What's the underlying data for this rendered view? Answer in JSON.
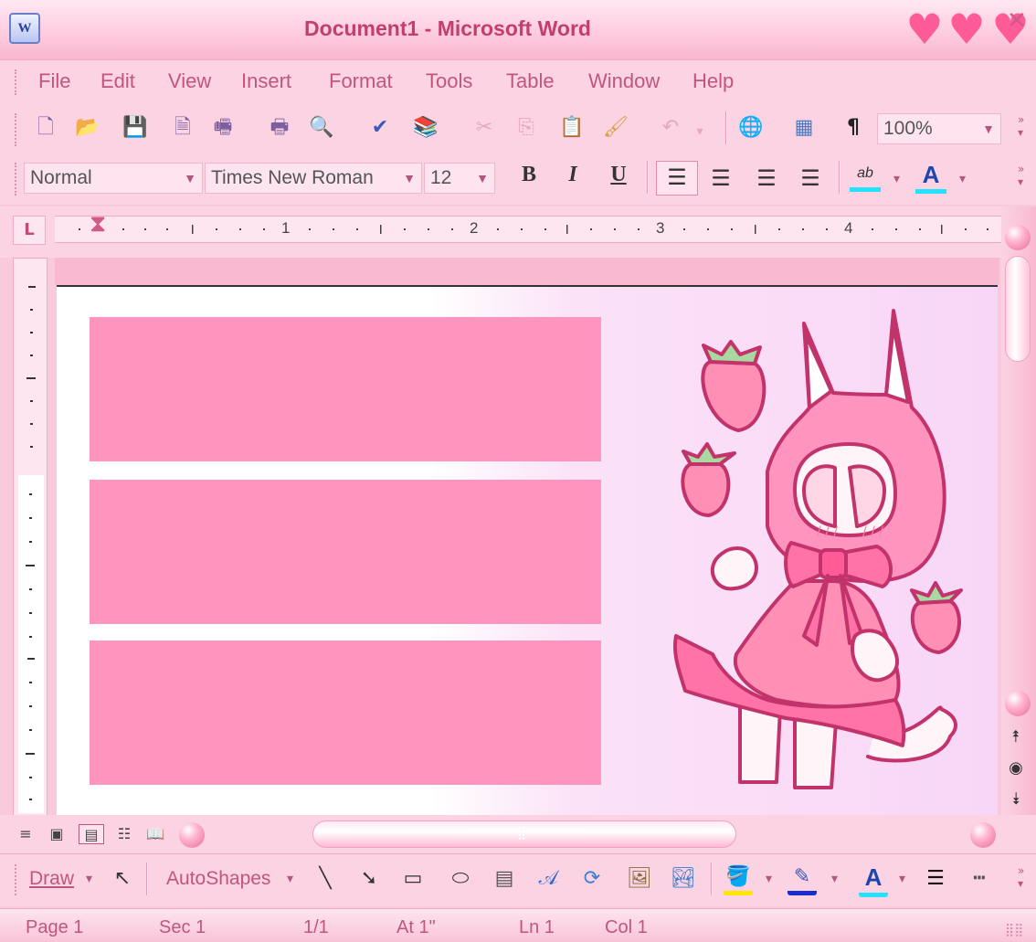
{
  "window": {
    "title": "Document1 - Microsoft Word",
    "app_icon": "word-icon",
    "hearts": [
      "♥",
      "♥",
      "♥"
    ],
    "close_glyph": "✕"
  },
  "menu": {
    "items": [
      "File",
      "Edit",
      "View",
      "Insert",
      "Format",
      "Tools",
      "Table",
      "Window",
      "Help"
    ]
  },
  "standard_toolbar": {
    "zoom": "100%",
    "paragraph_mark": "¶"
  },
  "formatting_toolbar": {
    "style": "Normal",
    "font": "Times New Roman",
    "size": "12",
    "bold": "B",
    "italic": "I",
    "underline": "U",
    "font_color_letter": "A",
    "highlight_label": "ab"
  },
  "ruler": {
    "numbers": [
      "1",
      "2",
      "3",
      "4"
    ],
    "tab_marker": "L"
  },
  "draw_toolbar": {
    "draw_label": "Draw",
    "autoshapes_label": "AutoShapes",
    "font_color_letter": "A"
  },
  "status": {
    "page": "Page  1",
    "sec": "Sec  1",
    "pages": "1/1",
    "at": "At  1\"",
    "ln": "Ln  1",
    "col": "Col  1"
  },
  "colors": {
    "accent": "#ff95bf",
    "text_pink": "#c0567e",
    "chrome": "#fbd3e3"
  }
}
